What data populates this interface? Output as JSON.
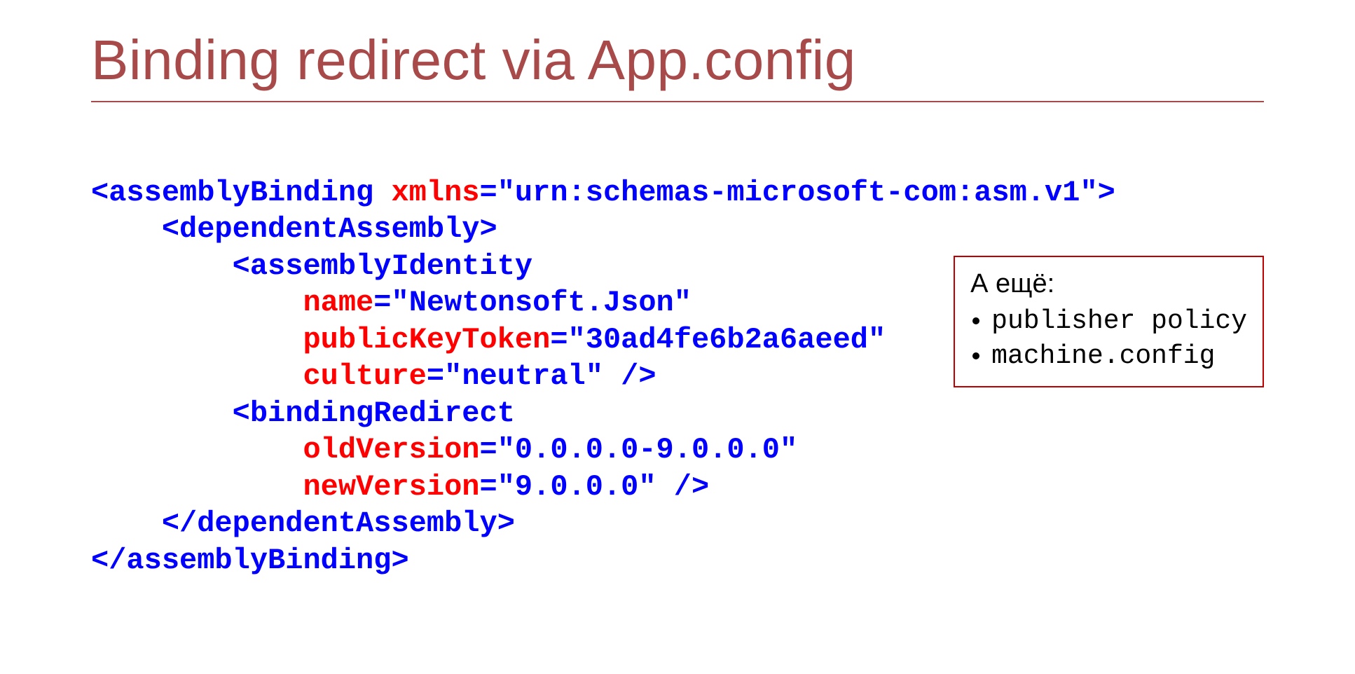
{
  "title": "Binding redirect via App.config",
  "code": {
    "l1": {
      "a": "<assemblyBinding",
      "b": " xmlns",
      "c": "=",
      "d": "\"urn:schemas-microsoft-com:asm.v1\"",
      "e": ">"
    },
    "l2": {
      "a": "    <dependentAssembly>"
    },
    "l3": {
      "a": "        <assemblyIdentity"
    },
    "l4": {
      "a": "            name",
      "b": "=",
      "c": "\"Newtonsoft.Json\""
    },
    "l5": {
      "a": "            publicKeyToken",
      "b": "=",
      "c": "\"30ad4fe6b2a6aeed\""
    },
    "l6": {
      "a": "            culture",
      "b": "=",
      "c": "\"neutral\"",
      "d": " />"
    },
    "l7": {
      "a": "        <bindingRedirect"
    },
    "l8": {
      "a": "            oldVersion",
      "b": "=",
      "c": "\"0.0.0.0-9.0.0.0\""
    },
    "l9": {
      "a": "            newVersion",
      "b": "=",
      "c": "\"9.0.0.0\"",
      "d": " />"
    },
    "l10": {
      "a": "    </dependentAssembly>"
    },
    "l11": {
      "a": "</assemblyBinding>"
    }
  },
  "note": {
    "title": "А ещё:",
    "items": [
      "publisher policy",
      "machine.config"
    ]
  }
}
